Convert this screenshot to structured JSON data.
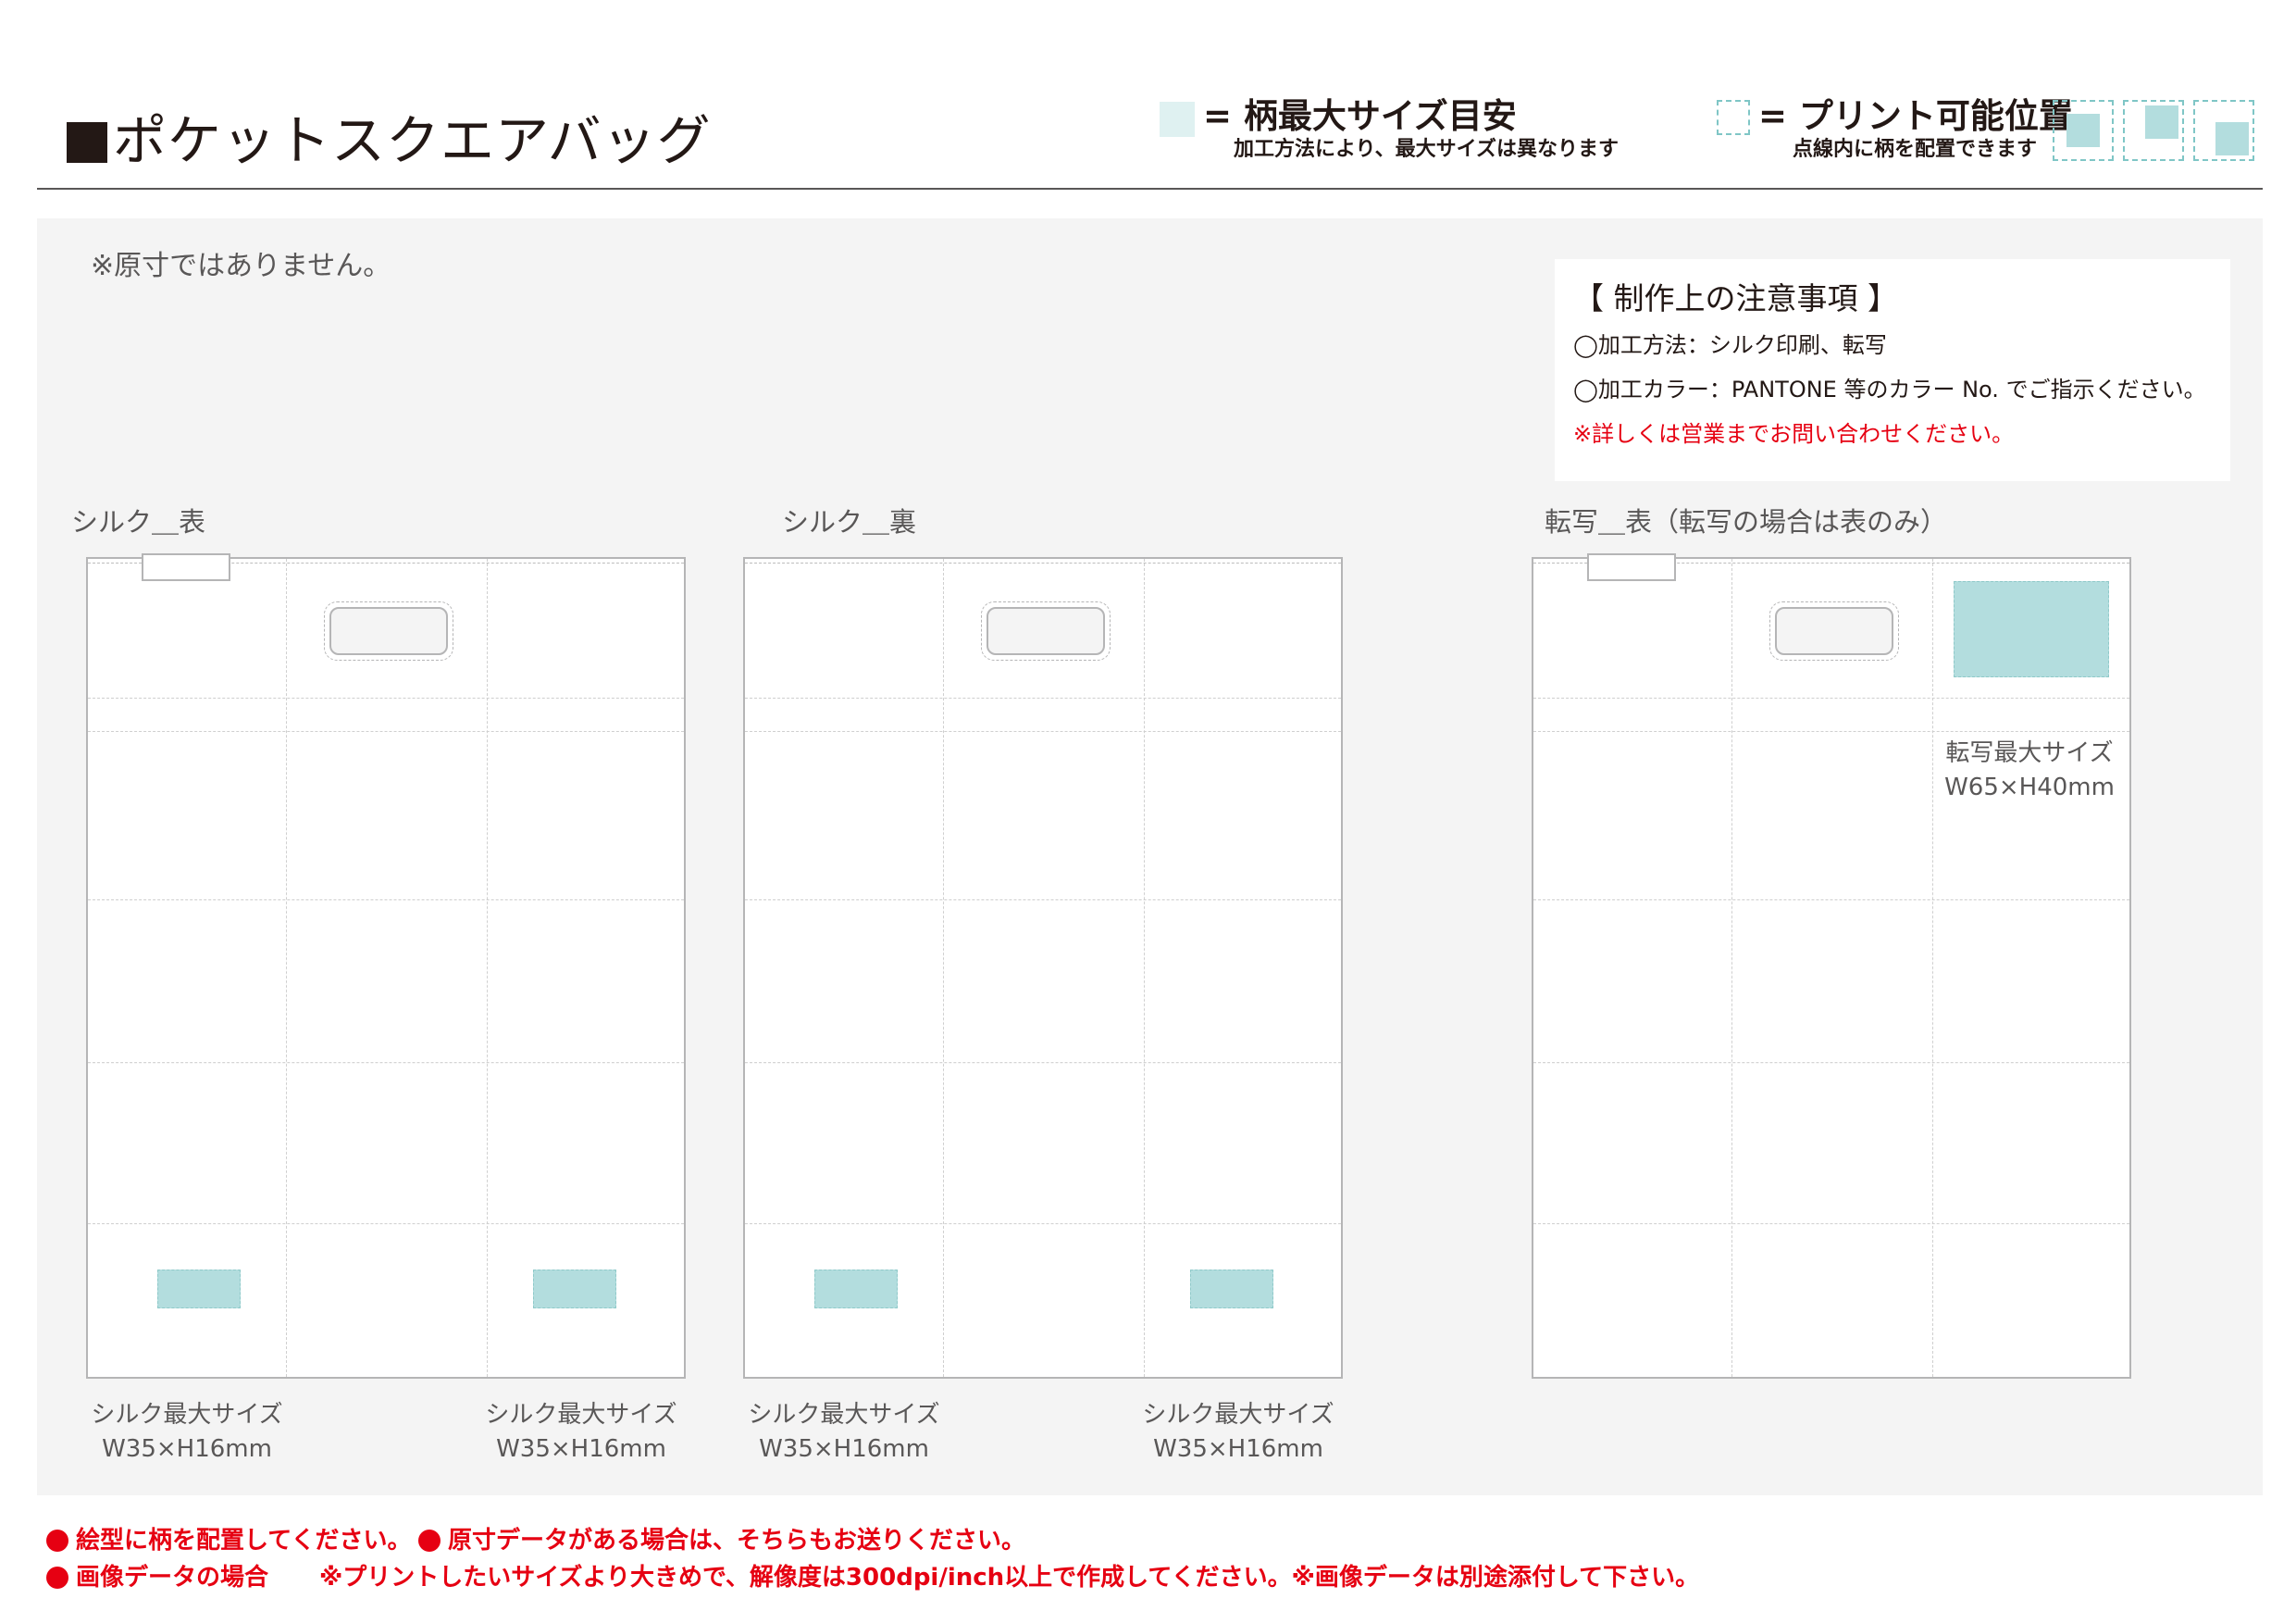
{
  "header": {
    "title": "ポケットスクエアバッグ",
    "legend_max": {
      "label": "= 柄最大サイズ目安",
      "note": "加工方法により、最大サイズは異なります"
    },
    "legend_print": {
      "label": "= プリント可能位置",
      "note": "点線内に柄を配置できます"
    }
  },
  "panel": {
    "scale_note": "※原寸ではありません。",
    "notes": {
      "heading": "【 制作上の注意事項 】",
      "method": "◯加工方法：シルク印刷、転写",
      "color": "◯加工カラー：PANTONE 等のカラー No. でご指示ください。",
      "contact": "※詳しくは営業までお問い合わせください。"
    },
    "views": [
      {
        "label": "シルク＿表"
      },
      {
        "label": "シルク＿裏"
      },
      {
        "label": "転写＿表（転写の場合は表のみ）"
      }
    ],
    "size_labels": {
      "silk_name": "シルク最大サイズ",
      "silk_dim": "W35×H16mm",
      "transfer_name": "転写最大サイズ",
      "transfer_dim": "W65×H40mm"
    }
  },
  "footer": {
    "line1a": "絵型に柄を配置してください。",
    "line1b": "原寸データがある場合は、そちらもお送りください。",
    "line2a": "画像データの場合",
    "line2b": "※プリントしたいサイズより大きめで、解像度は300dpi/inch以上で作成してください。※画像データは別途添付して下さい。"
  },
  "colors": {
    "max_area": "#b3ddde",
    "legend_swatch": "#dff1f1",
    "panel_bg": "#f4f4f4",
    "warning": "#e60012"
  }
}
